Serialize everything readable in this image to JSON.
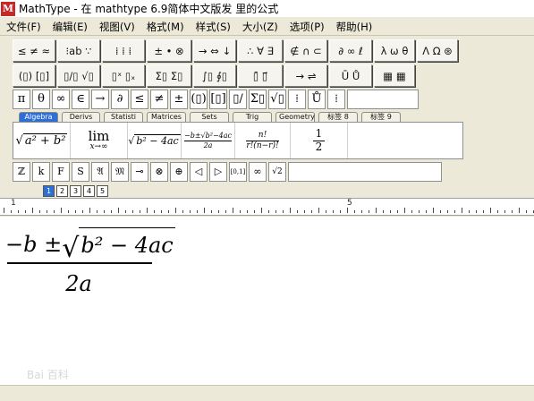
{
  "window": {
    "app_icon": "M",
    "title": "MathType - 在 mathtype 6.9简体中文版发 里的公式"
  },
  "menu": [
    {
      "label": "文件(F)"
    },
    {
      "label": "编辑(E)"
    },
    {
      "label": "视图(V)"
    },
    {
      "label": "格式(M)"
    },
    {
      "label": "样式(S)"
    },
    {
      "label": "大小(Z)"
    },
    {
      "label": "选项(P)"
    },
    {
      "label": "帮助(H)"
    }
  ],
  "palette_row1": [
    {
      "icon": "relations-palette-icon",
      "glyph": "≤ ≠ ≈"
    },
    {
      "icon": "spaces-palette-icon",
      "glyph": "⁝ab ∵"
    },
    {
      "icon": "embellishments-palette-icon",
      "glyph": "⁞ ⁞ ⁞"
    },
    {
      "icon": "operators-palette-icon",
      "glyph": "± • ⊗"
    },
    {
      "icon": "arrows-palette-icon",
      "glyph": "→ ⇔ ↓"
    },
    {
      "icon": "logic-palette-icon",
      "glyph": "∴ ∀ ∃"
    },
    {
      "icon": "sets-palette-icon",
      "glyph": "∉ ∩ ⊂"
    },
    {
      "icon": "misc-palette-icon",
      "glyph": "∂ ∞ ℓ"
    },
    {
      "icon": "greek-lower-palette-icon",
      "glyph": "λ ω θ"
    },
    {
      "icon": "greek-upper-palette-icon",
      "glyph": "Λ Ω ⊛"
    }
  ],
  "palette_row2": [
    {
      "icon": "fences-palette-icon",
      "glyph": "(▯) [▯]"
    },
    {
      "icon": "fractions-palette-icon",
      "glyph": "▯/▯ √▯"
    },
    {
      "icon": "scripts-palette-icon",
      "glyph": "▯ˣ ▯ₓ"
    },
    {
      "icon": "sums-palette-icon",
      "glyph": "Σ▯ Σ▯"
    },
    {
      "icon": "integrals-palette-icon",
      "glyph": "∫▯ ∮▯"
    },
    {
      "icon": "bars-palette-icon",
      "glyph": "▯̄ ▯⃗"
    },
    {
      "icon": "labeled-arrows-palette-icon",
      "glyph": "→ ⇌"
    },
    {
      "icon": "products-palette-icon",
      "glyph": "Ū Ů"
    },
    {
      "icon": "matrices-palette-icon",
      "glyph": "▦ ▦"
    }
  ],
  "symbol_row": [
    "π",
    "θ",
    "∞",
    "∈",
    "→",
    "∂",
    "≤",
    "≠",
    "±",
    "(▯)",
    "[▯]",
    "▯/▯",
    "Σ▯",
    "√▯",
    "⁞",
    "Ů",
    "⁞"
  ],
  "tabs": [
    {
      "label": "Algebra",
      "active": true
    },
    {
      "label": "Derivs"
    },
    {
      "label": "Statisti"
    },
    {
      "label": "Matrices"
    },
    {
      "label": "Sets"
    },
    {
      "label": "Trig"
    },
    {
      "label": "Geometry"
    },
    {
      "label": "标签 8"
    },
    {
      "label": "标签 9"
    }
  ],
  "templates": {
    "t1_sqrt": "a² + b²",
    "t2_lim": "lim",
    "t2_sub": "x→∞",
    "t3_sqrt": "b² − 4ac",
    "t4_num": "−b±√b²−4ac",
    "t4_den": "2a",
    "t5_num": "n!",
    "t5_den": "r!(n−r)!",
    "t6_num": "1",
    "t6_den": "2"
  },
  "small_row": [
    "ℤ",
    "k",
    "F",
    "S",
    "𝔄",
    "𝔐",
    "⊸",
    "⊗",
    "⊕",
    "◁",
    "▷",
    "[0,1]",
    "∞",
    "√2"
  ],
  "tabs2": [
    {
      "label": "1",
      "active": true
    },
    {
      "label": "2"
    },
    {
      "label": "3"
    },
    {
      "label": "4"
    },
    {
      "label": "5"
    }
  ],
  "ruler": {
    "marks": [
      "1",
      "5"
    ]
  },
  "formula": {
    "minus_b": "−b ±",
    "radicand": "b² − 4ac",
    "denominator": "2a"
  },
  "watermark": "Bai 百科",
  "colors": {
    "chrome": "#ece9d8",
    "accent": "#2e6fd6"
  }
}
